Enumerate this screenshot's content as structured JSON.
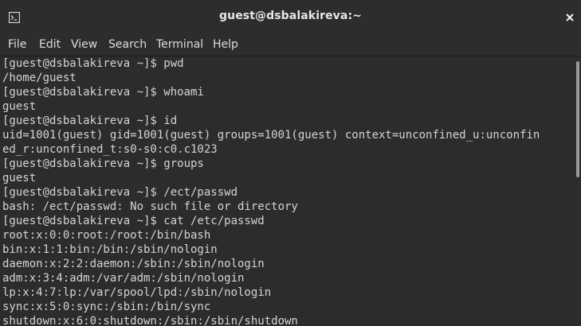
{
  "window": {
    "title": "guest@dsbalakireva:~"
  },
  "titlebar_icons": {
    "app": "terminal-icon",
    "close": "close-icon"
  },
  "menu": {
    "file": "File",
    "edit": "Edit",
    "view": "View",
    "search": "Search",
    "terminal": "Terminal",
    "help": "Help"
  },
  "terminal": {
    "lines": [
      "[guest@dsbalakireva ~]$ pwd",
      "/home/guest",
      "[guest@dsbalakireva ~]$ whoami",
      "guest",
      "[guest@dsbalakireva ~]$ id",
      "uid=1001(guest) gid=1001(guest) groups=1001(guest) context=unconfined_u:unconfin",
      "ed_r:unconfined_t:s0-s0:c0.c1023",
      "[guest@dsbalakireva ~]$ groups",
      "guest",
      "[guest@dsbalakireva ~]$ /ect/passwd",
      "bash: /ect/passwd: No such file or directory",
      "[guest@dsbalakireva ~]$ cat /etc/passwd",
      "root:x:0:0:root:/root:/bin/bash",
      "bin:x:1:1:bin:/bin:/sbin/nologin",
      "daemon:x:2:2:daemon:/sbin:/sbin/nologin",
      "adm:x:3:4:adm:/var/adm:/sbin/nologin",
      "lp:x:4:7:lp:/var/spool/lpd:/sbin/nologin",
      "sync:x:5:0:sync:/sbin:/bin/sync",
      "shutdown:x:6:0:shutdown:/sbin:/sbin/shutdown"
    ]
  },
  "colors": {
    "background": "#2c2c2c",
    "text": "#d4d4d4",
    "chrome": "#2d2d2d"
  }
}
